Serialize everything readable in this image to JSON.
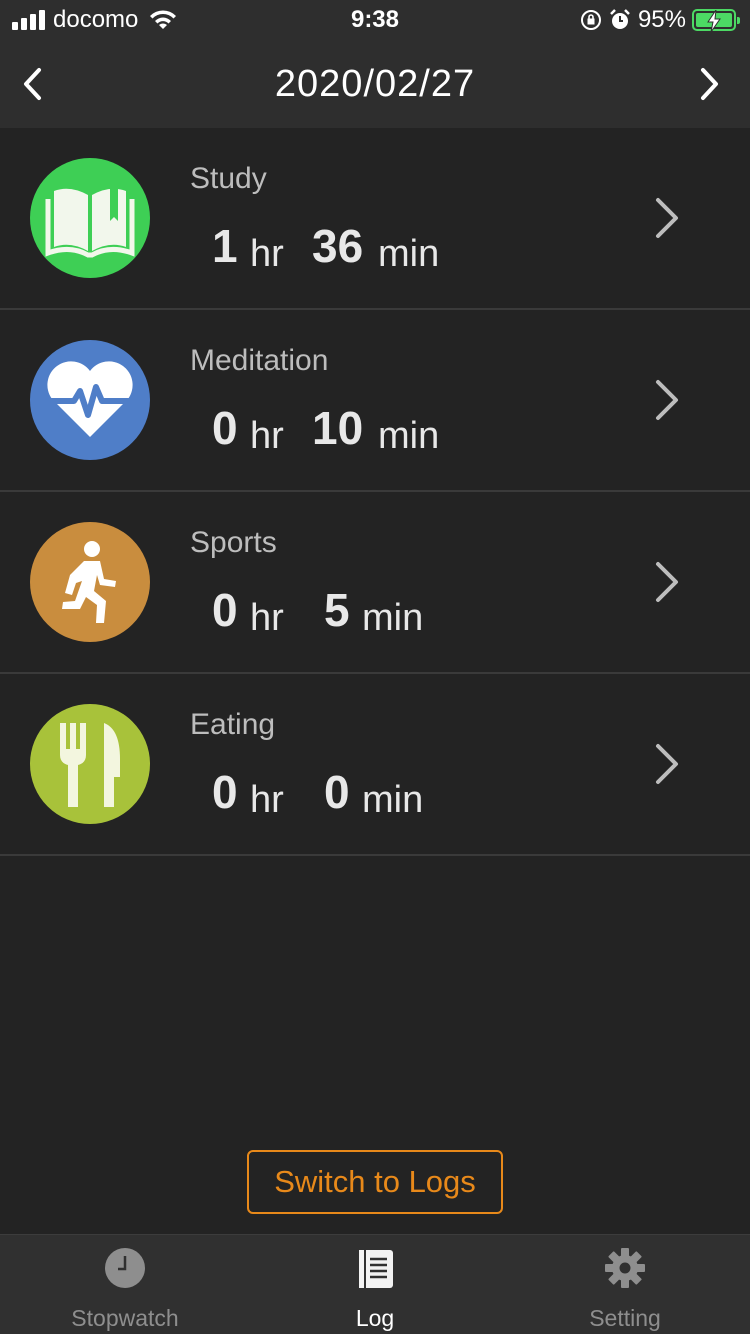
{
  "status_bar": {
    "carrier": "docomo",
    "time": "9:38",
    "battery_percent": "95%"
  },
  "header": {
    "date": "2020/02/27"
  },
  "activities": [
    {
      "name": "Study",
      "hours": "1",
      "minutes": "36",
      "hr_unit": "hr",
      "min_unit": "min",
      "icon": "book-icon",
      "color": "#3ecf55"
    },
    {
      "name": "Meditation",
      "hours": "0",
      "minutes": "10",
      "hr_unit": "hr",
      "min_unit": "min",
      "icon": "heartbeat-icon",
      "color": "#4f7ec8"
    },
    {
      "name": "Sports",
      "hours": "0",
      "minutes": "5",
      "hr_unit": "hr",
      "min_unit": "min",
      "icon": "running-icon",
      "color": "#c98d3e"
    },
    {
      "name": "Eating",
      "hours": "0",
      "minutes": "0",
      "hr_unit": "hr",
      "min_unit": "min",
      "icon": "fork-knife-icon",
      "color": "#a8c23a"
    }
  ],
  "switch_button": {
    "label": "Switch to Logs",
    "color": "#e8891a"
  },
  "tabs": [
    {
      "label": "Stopwatch",
      "icon": "clock-icon",
      "active": false
    },
    {
      "label": "Log",
      "icon": "document-icon",
      "active": true
    },
    {
      "label": "Setting",
      "icon": "gear-icon",
      "active": false
    }
  ]
}
